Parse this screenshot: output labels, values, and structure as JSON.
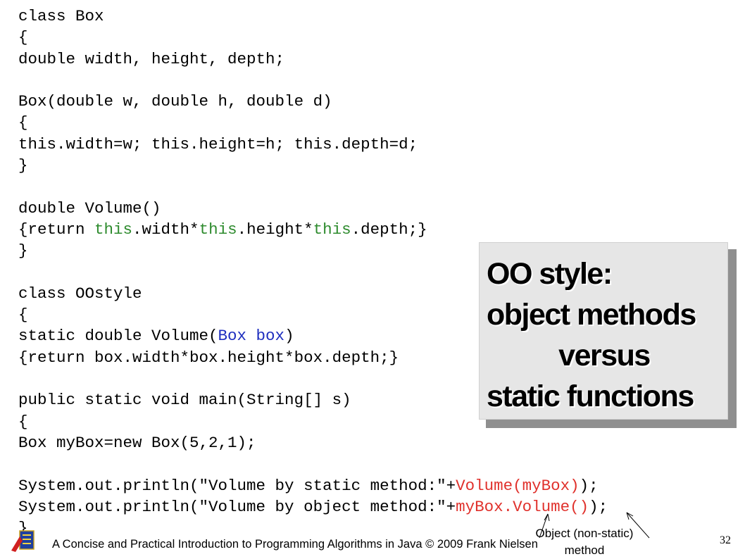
{
  "code_lines": [
    [
      {
        "t": "class Box"
      }
    ],
    [
      {
        "t": "{"
      }
    ],
    [
      {
        "t": "double width, height, depth;"
      }
    ],
    [
      {
        "t": ""
      }
    ],
    [
      {
        "t": "Box(double w, double h, double d)"
      }
    ],
    [
      {
        "t": "{"
      }
    ],
    [
      {
        "t": "this.width=w; this.height=h; this.depth=d;"
      }
    ],
    [
      {
        "t": "}"
      }
    ],
    [
      {
        "t": ""
      }
    ],
    [
      {
        "t": "double Volume()"
      }
    ],
    [
      {
        "t": "{return "
      },
      {
        "t": "this",
        "c": "green"
      },
      {
        "t": ".width*"
      },
      {
        "t": "this",
        "c": "green"
      },
      {
        "t": ".height*"
      },
      {
        "t": "this",
        "c": "green"
      },
      {
        "t": ".depth;}"
      }
    ],
    [
      {
        "t": "}"
      }
    ],
    [
      {
        "t": ""
      }
    ],
    [
      {
        "t": "class OOstyle"
      }
    ],
    [
      {
        "t": "{"
      }
    ],
    [
      {
        "t": "static double Volume("
      },
      {
        "t": "Box box",
        "c": "blue"
      },
      {
        "t": ")"
      }
    ],
    [
      {
        "t": "{return box.width*box.height*box.depth;}"
      }
    ],
    [
      {
        "t": ""
      }
    ],
    [
      {
        "t": "public static void main(String[] s)"
      }
    ],
    [
      {
        "t": "{"
      }
    ],
    [
      {
        "t": "Box myBox=new Box(5,2,1);"
      }
    ],
    [
      {
        "t": ""
      }
    ],
    [
      {
        "t": "System.out.println(\"Volume by static method:\"+"
      },
      {
        "t": "Volume(myBox)",
        "c": "red"
      },
      {
        "t": ");"
      }
    ],
    [
      {
        "t": "System.out.println(\"Volume by object method:\"+"
      },
      {
        "t": "myBox.Volume()",
        "c": "red"
      },
      {
        "t": ");"
      }
    ],
    [
      {
        "t": "}"
      }
    ]
  ],
  "colors": {
    "green": "#2e8b2e",
    "blue": "#1f2fbf",
    "red": "#e0312c"
  },
  "callout": {
    "line1": "OO style:",
    "line2": "object methods",
    "line3": "versus",
    "line4": "static functions"
  },
  "annotation": {
    "line1": "Object (non-static)",
    "line2": "method"
  },
  "footer": {
    "text": "A Concise and Practical Introduction to Programming Algorithms in Java  © 2009 Frank Nielsen",
    "page_number": "32"
  },
  "logo_icon": "school-crest-icon"
}
